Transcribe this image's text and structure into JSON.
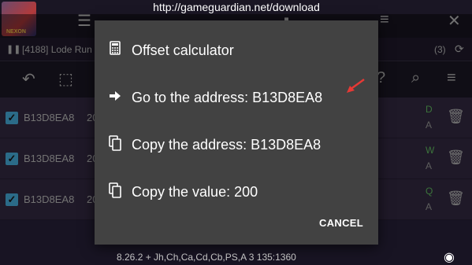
{
  "browser": {
    "url": "http://gameguardian.net/download"
  },
  "app": {
    "logo_text": "NEXON",
    "process_label": "[4188] Lode Run",
    "result_count": "(3)",
    "status_line": "8.26.2  + Jh,Ch,Ca,Cd,Cb,PS,A  3  135:1360"
  },
  "results": [
    {
      "address": "B13D8EA8",
      "value": "20",
      "flag": "D",
      "type": "A",
      "checked": true
    },
    {
      "address": "B13D8EA8",
      "value": "20",
      "flag": "W",
      "type": "A",
      "checked": true
    },
    {
      "address": "B13D8EA8",
      "value": "20",
      "flag": "Q",
      "type": "A",
      "checked": true
    }
  ],
  "dialog": {
    "items": [
      {
        "label": "Offset calculator",
        "icon": "calculator-icon"
      },
      {
        "label": "Go to the address: B13D8EA8",
        "icon": "arrow-right-icon"
      },
      {
        "label": "Copy the address: B13D8EA8",
        "icon": "copy-icon"
      },
      {
        "label": "Copy the value: 200",
        "icon": "copy-icon"
      }
    ],
    "cancel_label": "CANCEL"
  },
  "colors": {
    "dialog_bg": "#424242",
    "checkbox": "#4fc3f7",
    "pointer_arrow": "#e53935"
  }
}
